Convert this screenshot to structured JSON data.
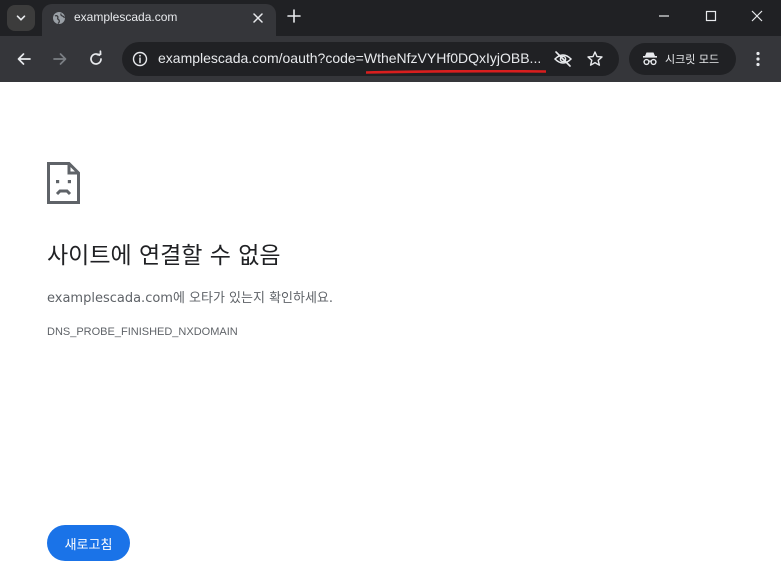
{
  "tab": {
    "title": "examplescada.com",
    "favicon": "globe-icon"
  },
  "toolbar": {
    "url": "examplescada.com/oauth?code=WtheNfzVYHf0DQxIyjOBB...",
    "incognito_label": "시크릿 모드"
  },
  "error_page": {
    "heading": "사이트에 연결할 수 없음",
    "description": "examplescada.com에 오타가 있는지 확인하세요.",
    "error_code": "DNS_PROBE_FINISHED_NXDOMAIN",
    "reload_label": "새로고침"
  },
  "colors": {
    "titlebar": "#202124",
    "toolbar": "#35363a",
    "accent_blue": "#1a73e8",
    "annotation_red": "#d91e1e"
  }
}
